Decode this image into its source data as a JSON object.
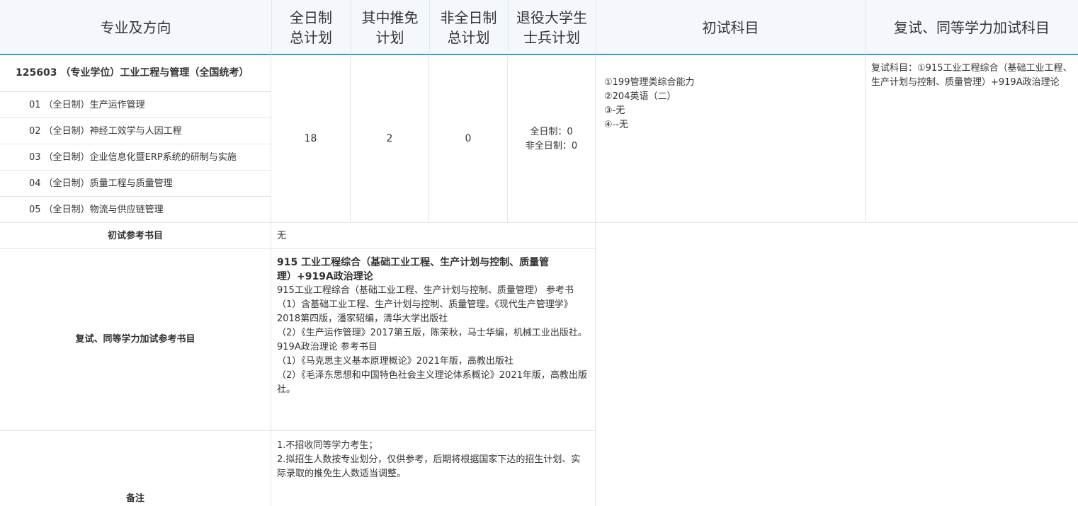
{
  "header": {
    "col_major": "专业及方向",
    "col_full_plan": "全日制\n总计划",
    "col_exempt": "其中推免\n计划",
    "col_part_plan": "非全日制\n总计划",
    "col_veteran": "退役大学生\n士兵计划",
    "col_initial": "初试科目",
    "col_retest": "复试、同等学力加试科目"
  },
  "program": {
    "title": "125603 （专业学位）工业工程与管理（全国统考）",
    "directions": [
      "01 （全日制）生产运作管理",
      "02 （全日制）神经工效学与人因工程",
      "03 （全日制）企业信息化暨ERP系统的研制与实施",
      "04 （全日制）质量工程与质量管理",
      "05 （全日制）物流与供应链管理"
    ],
    "full_plan": "18",
    "exempt": "2",
    "part_plan": "0",
    "veteran": "全日制：0\n非全日制：0",
    "initial_subjects": "①199管理类综合能力\n②204英语（二）\n③-无\n④--无",
    "retest_subjects": "复试科目：①915工业工程综合（基础工业工程、生产计划与控制、质量管理）+919A政治理论"
  },
  "refs": {
    "initial_label": "初试参考书目",
    "initial_value": "无",
    "retest_label": "复试、同等学力加试参考书目",
    "retest_heading": "915 工业工程综合（基础工业工程、生产计划与控制、质量管理）+919A政治理论",
    "retest_body": "915工业工程综合（基础工业工程、生产计划与控制、质量管理） 参考书\n（1）含基础工业工程、生产计划与控制、质量管理。《现代生产管理学》2018第四版，潘家轺编，清华大学出版社\n（2）《生产运作管理》2017第五版，陈荣秋，马士华编，机械工业出版社。\n919A政治理论 参考书目\n（1）《马克思主义基本原理概论》2021年版，高教出版社\n（2）《毛泽东思想和中国特色社会主义理论体系概论》2021年版，高教出版社。",
    "remark_label": "备注",
    "remark_value": "1.不招收同等学力考生；\n2.拟招生人数按专业划分，仅供参考，后期将根据国家下达的招生计划、实际录取的推免生人数适当调整。"
  }
}
